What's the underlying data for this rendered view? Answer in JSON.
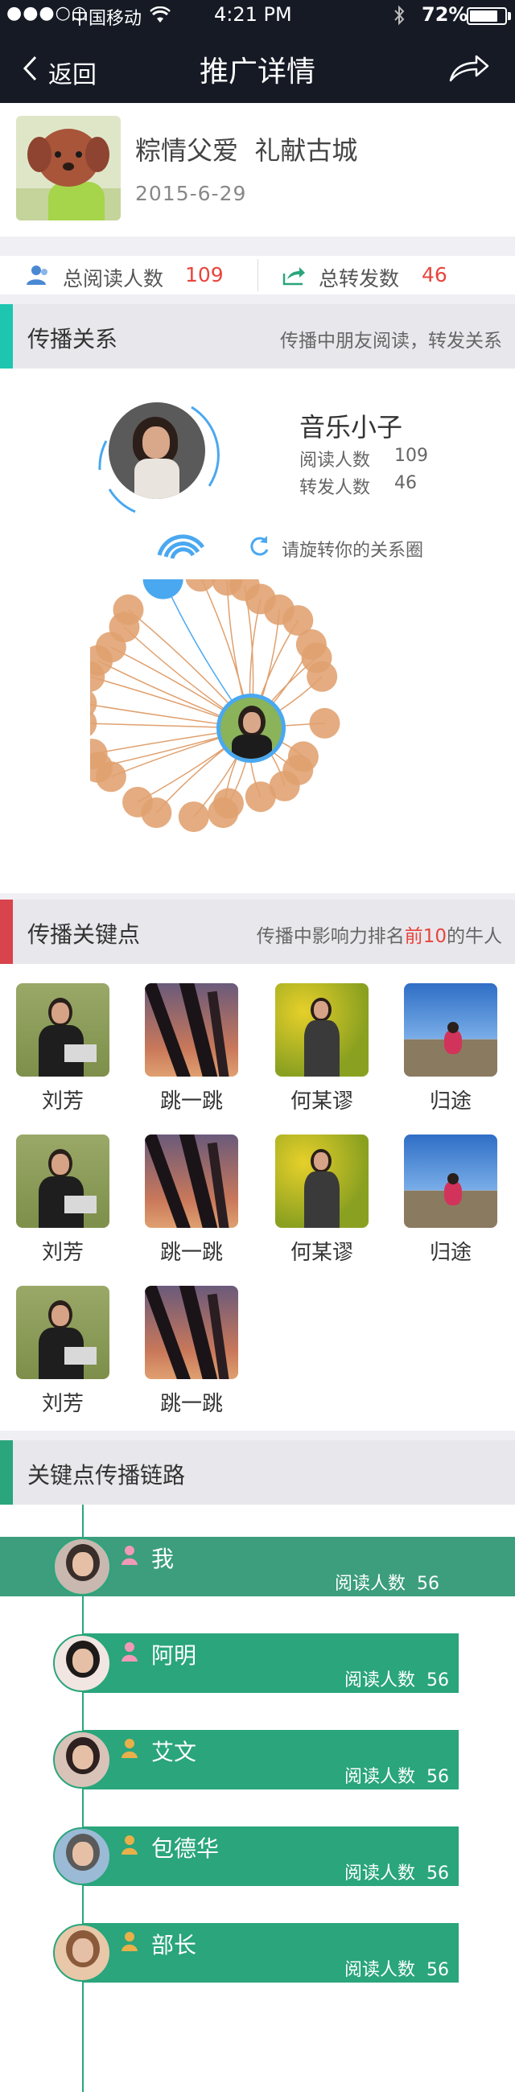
{
  "status_bar": {
    "signal": "●●●○○",
    "carrier": "中国移动",
    "time": "4:21 PM",
    "battery": "72%"
  },
  "nav": {
    "back_label": "返回",
    "title": "推广详情"
  },
  "article": {
    "title": "粽情父爱  礼献古城",
    "date": "2015-6-29"
  },
  "stats": {
    "read_label": "总阅读人数",
    "read_value": "109",
    "share_label": "总转发数",
    "share_value": "46"
  },
  "relation": {
    "header": "传播关系",
    "header_desc": "传播中朋友阅读，转发关系",
    "user_name": "音乐小子",
    "read_label": "阅读人数",
    "read_value": "109",
    "share_label": "转发人数",
    "share_value": "46",
    "rotate_hint": "请旋转你的关系圈"
  },
  "keypoints": {
    "header": "传播关键点",
    "desc_prefix": "传播中影响力排名",
    "desc_highlight": "前10",
    "desc_suffix": "的牛人",
    "people": [
      {
        "name": "刘芳",
        "photo": "grass"
      },
      {
        "name": "跳一跳",
        "photo": "sunset"
      },
      {
        "name": "何某谬",
        "photo": "flowers"
      },
      {
        "name": "归途",
        "photo": "mountain"
      },
      {
        "name": "刘芳",
        "photo": "grass"
      },
      {
        "name": "跳一跳",
        "photo": "sunset"
      },
      {
        "name": "何某谬",
        "photo": "flowers"
      },
      {
        "name": "归途",
        "photo": "mountain"
      },
      {
        "name": "刘芳",
        "photo": "grass"
      },
      {
        "name": "跳一跳",
        "photo": "sunset"
      }
    ]
  },
  "chain": {
    "header": "关键点传播链路",
    "items": [
      {
        "name": "我",
        "read_label": "阅读人数",
        "read_value": "56",
        "icon": "female-user-icon"
      },
      {
        "name": "阿明",
        "read_label": "阅读人数",
        "read_value": "56",
        "icon": "female-user-icon"
      },
      {
        "name": "艾文",
        "read_label": "阅读人数",
        "read_value": "56",
        "icon": "male-user-icon"
      },
      {
        "name": "包德华",
        "read_label": "阅读人数",
        "read_value": "56",
        "icon": "male-user-icon"
      },
      {
        "name": "部长",
        "read_label": "阅读人数",
        "read_value": "56",
        "icon": "male-user-icon"
      }
    ]
  },
  "colors": {
    "accent_red": "#e8453c",
    "teal": "#1ec6b0",
    "red_bar": "#d9434b",
    "green": "#2aa57c",
    "blue": "#4aa8f0",
    "orange": "#e0a06e"
  }
}
